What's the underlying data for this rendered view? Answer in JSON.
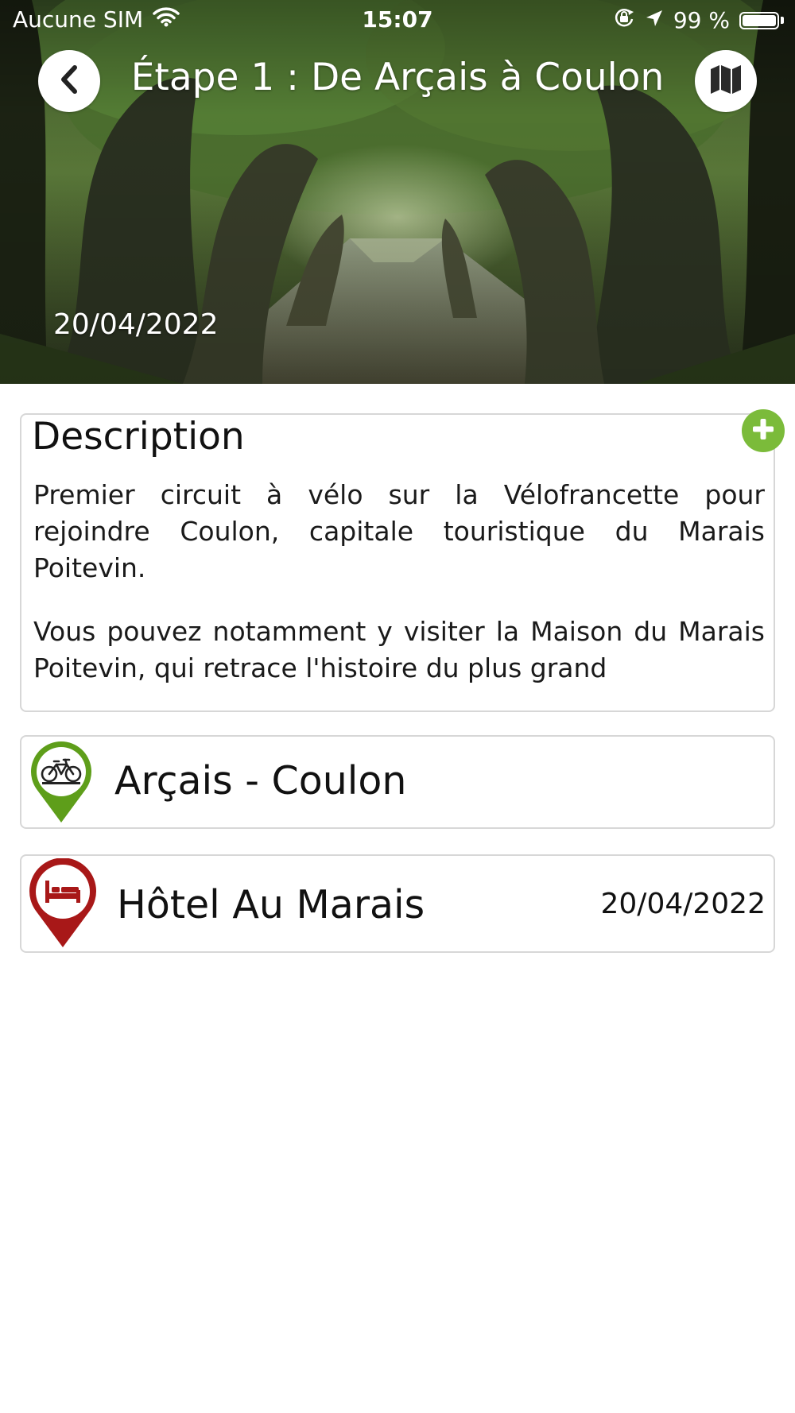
{
  "status_bar": {
    "carrier": "Aucune SIM",
    "time": "15:07",
    "battery_text": "99 %",
    "battery_level": 0.99
  },
  "nav": {
    "title": "Étape 1 : De Arçais à Coulon",
    "back_icon": "chevron-left-icon",
    "map_icon": "map-icon"
  },
  "hero": {
    "date": "20/04/2022"
  },
  "description": {
    "title": "Description",
    "paragraphs": [
      "Premier circuit à vélo sur la Vélofrancette pour rejoindre Coulon, capitale touristique du Marais Poitevin.",
      "Vous pouvez notamment y visiter la Maison du Marais Poitevin, qui retrace l'histoire du plus grand"
    ],
    "expand_icon": "plus-icon"
  },
  "items": [
    {
      "label": "Arçais - Coulon",
      "icon": "bicycle-pin-icon",
      "color": "#5e9e1a"
    },
    {
      "label": "Hôtel Au Marais",
      "date": "20/04/2022",
      "icon": "bed-pin-icon",
      "color": "#a81818"
    }
  ],
  "colors": {
    "accent_green": "#7bbb3a",
    "route_green": "#5e9e1a",
    "hotel_red": "#a81818",
    "card_border": "#d7d7d7"
  }
}
